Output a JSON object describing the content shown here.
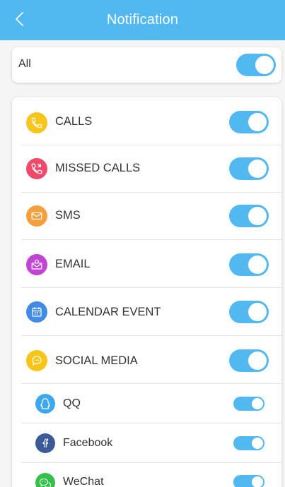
{
  "header": {
    "title": "Notification"
  },
  "all": {
    "label": "All",
    "enabled": true
  },
  "items": [
    {
      "label": "CALLS",
      "icon": "phone-icon",
      "color": "#f7c51a",
      "enabled": true
    },
    {
      "label": "MISSED CALLS",
      "icon": "missed-call-icon",
      "color": "#f04a6b",
      "enabled": true
    },
    {
      "label": "SMS",
      "icon": "envelope-icon",
      "color": "#f5a03c",
      "enabled": true
    },
    {
      "label": "EMAIL",
      "icon": "email-icon",
      "color": "#c144d4",
      "enabled": true
    },
    {
      "label": "CALENDAR EVENT",
      "icon": "calendar-icon",
      "color": "#3f8be6",
      "enabled": true
    },
    {
      "label": "SOCIAL MEDIA",
      "icon": "chat-bubble-icon",
      "color": "#f7c51a",
      "enabled": true
    }
  ],
  "social_apps": [
    {
      "label": "QQ",
      "icon": "qq-icon",
      "color": "#3ea8ee",
      "enabled": true
    },
    {
      "label": "Facebook",
      "icon": "facebook-icon",
      "color": "#3c5a99",
      "enabled": true
    },
    {
      "label": "WeChat",
      "icon": "wechat-icon",
      "color": "#35c04b",
      "enabled": true
    }
  ],
  "colors": {
    "accent": "#51b8f2",
    "background": "#f5f5f5",
    "card": "#ffffff",
    "separator": "#e5e5e5",
    "text": "#333333"
  }
}
